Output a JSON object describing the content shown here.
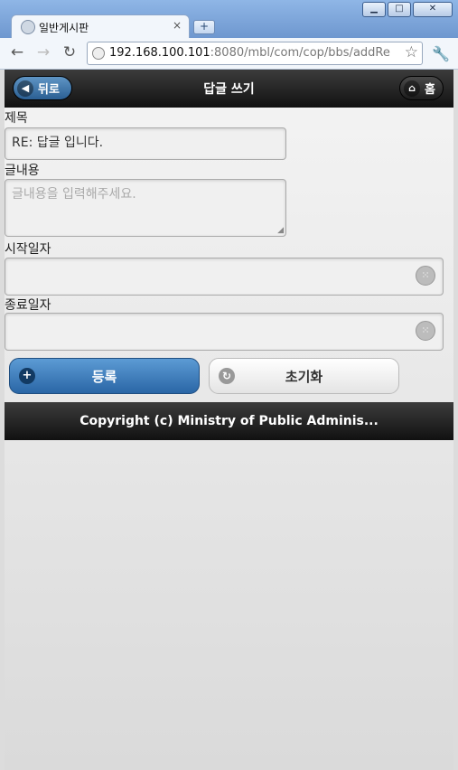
{
  "browser": {
    "tab_title": "일반게시판",
    "url_host": "192.168.100.101",
    "url_rest": ":8080/mbl/com/cop/bbs/addRe"
  },
  "header": {
    "back_label": "뒤로",
    "title": "답글 쓰기",
    "home_label": "홈"
  },
  "form": {
    "subject_label": "제목",
    "subject_value": "RE: 답글 입니다.",
    "content_label": "글내용",
    "content_placeholder": "글내용을 입력해주세요.",
    "start_date_label": "시작일자",
    "start_date_value": "",
    "end_date_label": "종료일자",
    "end_date_value": ""
  },
  "buttons": {
    "register_label": "등록",
    "reset_label": "초기화"
  },
  "footer": {
    "text": "Copyright (c) Ministry of Public Adminis..."
  }
}
